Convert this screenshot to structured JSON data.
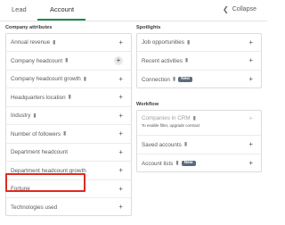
{
  "tabs": {
    "lead": "Lead",
    "account": "Account",
    "collapse_label": "Collapse",
    "collapse_icon": "chevron-left-icon"
  },
  "company_attributes": {
    "heading": "Company attributes",
    "items": [
      {
        "label": "Annual revenue",
        "pinned": true
      },
      {
        "label": "Company headcount",
        "pinned": true
      },
      {
        "label": "Company headcount growth",
        "pinned": true
      },
      {
        "label": "Headquarters location",
        "pinned": true
      },
      {
        "label": "Industry",
        "pinned": true
      },
      {
        "label": "Number of followers",
        "pinned": true
      },
      {
        "label": "Department headcount",
        "pinned": false
      },
      {
        "label": "Department headcount growth",
        "pinned": false
      },
      {
        "label": "Fortune",
        "pinned": false
      },
      {
        "label": "Technologies used",
        "pinned": false
      }
    ]
  },
  "spotlights": {
    "heading": "Spotlights",
    "items": [
      {
        "label": "Job opportunities",
        "pinned": true
      },
      {
        "label": "Recent activities",
        "pinned": true
      },
      {
        "label": "Connection",
        "pinned": true,
        "badge": "New"
      }
    ]
  },
  "workflow": {
    "heading": "Workflow",
    "items": [
      {
        "label": "Companies in CRM",
        "pinned": true,
        "note": "To enable filter, upgrade contract"
      },
      {
        "label": "Saved accounts",
        "pinned": true
      },
      {
        "label": "Account lists",
        "pinned": true,
        "badge": "New"
      }
    ]
  },
  "colors": {
    "active_tab_underline": "#1f8a4c",
    "highlight": "#e0291f",
    "badge": "#5b6b7d"
  }
}
